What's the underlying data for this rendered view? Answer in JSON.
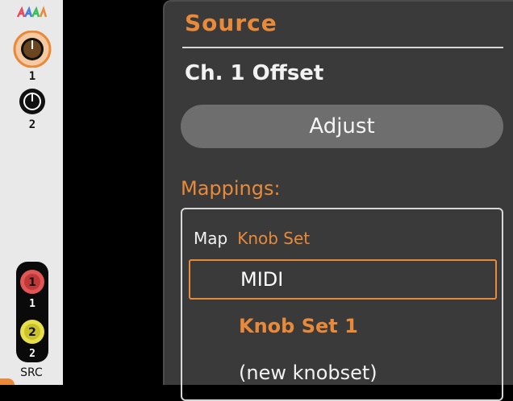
{
  "module": {
    "knobs": [
      {
        "label": "1",
        "color": "#5a3a15",
        "ring": "#e88a3a",
        "selected": true
      },
      {
        "label": "2",
        "color": "#111111",
        "ring": "#111111",
        "selected": false
      }
    ],
    "jacks": [
      {
        "label": "1",
        "color": "#e05555",
        "text": "1"
      },
      {
        "label": "2",
        "color": "#e8e04a",
        "text": "2"
      }
    ],
    "src_label": "SRC"
  },
  "panel": {
    "title": "Source",
    "parameter": "Ch. 1 Offset",
    "adjust_label": "Adjust",
    "mappings_label": "Mappings:",
    "map_header_key": "Map",
    "map_header_value": "Knob Set",
    "options": [
      {
        "label": "MIDI",
        "style": "selected"
      },
      {
        "label": "Knob Set 1",
        "style": "orange"
      },
      {
        "label": "(new knobset)",
        "style": "white"
      }
    ]
  },
  "colors": {
    "accent": "#e88a3a",
    "panel_bg": "#3a3a3a",
    "button_bg": "#6e6e6e"
  }
}
